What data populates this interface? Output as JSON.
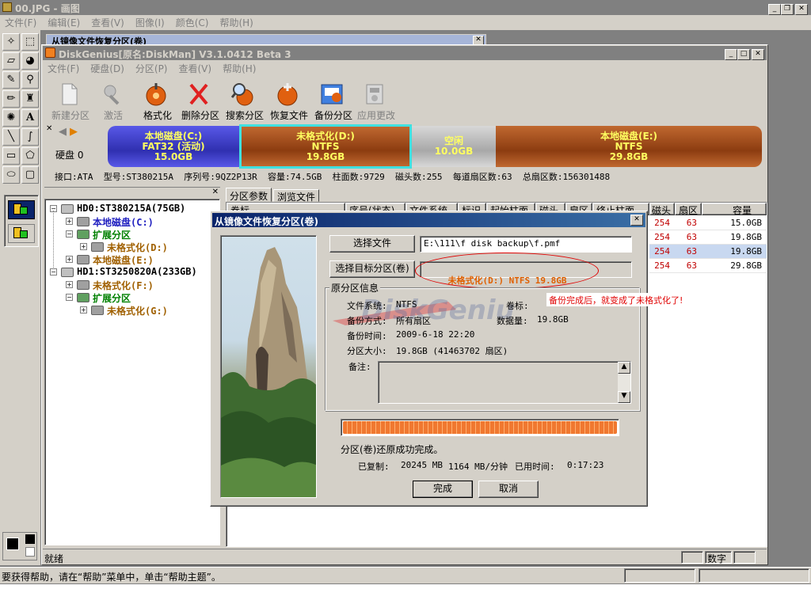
{
  "outer": {
    "title": "00.JPG - 画图",
    "menu": [
      "文件(F)",
      "编辑(E)",
      "查看(V)",
      "图像(I)",
      "颜色(C)",
      "帮助(H)"
    ],
    "controls": [
      "_",
      "❐",
      "✕"
    ],
    "status": "要获得帮助，请在“帮助”菜单中，单击“帮助主题”。"
  },
  "bg_window_title": "从镜像文件恢复分区(卷)",
  "dg": {
    "title": "DiskGenius[原名:DiskMan] V3.1.0412 Beta 3",
    "menu": [
      "文件(F)",
      "硬盘(D)",
      "分区(P)",
      "查看(V)",
      "帮助(H)"
    ],
    "toolbar": [
      {
        "label": "新建分区",
        "icon": "new-partition-icon",
        "enabled": false
      },
      {
        "label": "激活",
        "icon": "activate-icon",
        "enabled": false
      },
      {
        "label": "格式化",
        "icon": "format-icon",
        "enabled": true
      },
      {
        "label": "删除分区",
        "icon": "delete-partition-icon",
        "enabled": true
      },
      {
        "label": "搜索分区",
        "icon": "search-partition-icon",
        "enabled": true
      },
      {
        "label": "恢复文件",
        "icon": "recover-files-icon",
        "enabled": true
      },
      {
        "label": "备份分区",
        "icon": "backup-partition-icon",
        "enabled": true
      },
      {
        "label": "应用更改",
        "icon": "apply-changes-icon",
        "enabled": false
      }
    ],
    "disk_label": "硬盘 0",
    "disk_map": [
      {
        "name": "本地磁盘(C:)",
        "fs": "FAT32 (活动)",
        "size": "15.0GB",
        "color": "#4040d0",
        "text": "#ffff60"
      },
      {
        "name": "未格式化(D:)",
        "fs": "NTFS",
        "size": "19.8GB",
        "color": "#a0501c",
        "text": "#ffff60"
      },
      {
        "name": "空闲",
        "fs": "",
        "size": "10.0GB",
        "color": "#b8b8b8",
        "text": "#ffff60"
      },
      {
        "name": "本地磁盘(E:)",
        "fs": "NTFS",
        "size": "29.8GB",
        "color": "#a0501c",
        "text": "#ffff60"
      }
    ],
    "disk_info": "接口:ATA  型号:ST380215A  序列号:9QZ2P13R  容量:74.5GB  柱面数:9729  磁头数:255  每道扇区数:63  总扇区数:156301488",
    "tree": [
      {
        "text": "HD0:ST380215A(75GB)",
        "level": 0,
        "color": "#000000",
        "pm": "−"
      },
      {
        "text": "本地磁盘(C:)",
        "level": 1,
        "color": "#2020c0",
        "pm": "+"
      },
      {
        "text": "扩展分区",
        "level": 1,
        "color": "#008000",
        "pm": "−"
      },
      {
        "text": "未格式化(D:)",
        "level": 2,
        "color": "#a06000",
        "pm": "+"
      },
      {
        "text": "本地磁盘(E:)",
        "level": 1,
        "color": "#a06000",
        "pm": "+"
      },
      {
        "text": "HD1:ST3250820A(233GB)",
        "level": 0,
        "color": "#000000",
        "pm": "−"
      },
      {
        "text": "未格式化(F:)",
        "level": 1,
        "color": "#a06000",
        "pm": "+"
      },
      {
        "text": "扩展分区",
        "level": 1,
        "color": "#008000",
        "pm": "−"
      },
      {
        "text": "未格式化(G:)",
        "level": 2,
        "color": "#a06000",
        "pm": "+"
      }
    ],
    "tabs": [
      "分区参数",
      "浏览文件"
    ],
    "col_headers": [
      "卷标",
      "序号(状态)",
      "文件系统",
      "标识",
      "起始柱面",
      "磁头",
      "扇区",
      "终止柱面",
      "磁头",
      "扇区",
      "容量"
    ],
    "rows": [
      {
        "head": "254",
        "sector": "63",
        "size": "15.0GB"
      },
      {
        "head": "254",
        "sector": "63",
        "size": "19.8GB"
      },
      {
        "head": "254",
        "sector": "63",
        "size": "19.8GB"
      },
      {
        "head": "254",
        "sector": "63",
        "size": "29.8GB"
      }
    ],
    "status_left": "就绪",
    "status_right": "数字"
  },
  "dialog": {
    "title": "从镜像文件恢复分区(卷)",
    "select_file_label": "选择文件",
    "file_path": "E:\\111\\f disk backup\\f.pmf",
    "select_target_label": "选择目标分区(卷)",
    "target_value": "未格式化(D:) NTFS 19.8GB",
    "group_title": "原分区信息",
    "info": {
      "fs_label": "文件系统:",
      "fs_value": "NTFS",
      "label_label": "卷标:",
      "backup_mode_label": "备份方式:",
      "backup_mode_value": "所有扇区",
      "data_label": "数据量:",
      "data_value": "19.8GB",
      "time_label": "备份时间:",
      "time_value": "2009-6-18 22:20",
      "size_label": "分区大小:",
      "size_value": "19.8GB  (41463702 扇区)",
      "note_label": "备注:"
    },
    "progress": 1.0,
    "done_message": "分区(卷)还原成功完成。",
    "stats": {
      "copied_label": "已复制:",
      "copied_value": "20245 MB",
      "speed_value": "1164 MB/分钟",
      "elapsed_label": "已用时间:",
      "elapsed_value": "0:17:23"
    },
    "ok_label": "完成",
    "cancel_label": "取消"
  },
  "annotation": "备份完成后，就变成了未格式化了!",
  "colors": {
    "title_active": "#0a246a",
    "title_inactive": "#808080",
    "face": "#d4d0c8",
    "annotation_red": "#e00000",
    "progress": "#f07830"
  }
}
